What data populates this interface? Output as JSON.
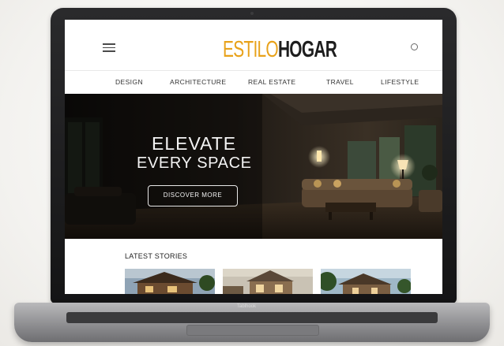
{
  "site": {
    "logo_part_a": "ESTILO",
    "logo_part_b": "HOGAR"
  },
  "nav": {
    "items": [
      {
        "label": "DESIGN"
      },
      {
        "label": "ARCHITECTURE"
      },
      {
        "label": "REAL ESTATE"
      },
      {
        "label": "TRAVEL"
      },
      {
        "label": "LIFESTYLE"
      }
    ]
  },
  "hero": {
    "headline_line1": "ELEVATE",
    "headline_line2": "EVERY SPACE",
    "cta_label": "DISCOVER MORE"
  },
  "stories": {
    "title": "LATEST STORIES"
  },
  "device": {
    "base_label": "Tablhook"
  },
  "colors": {
    "accent": "#e8a21a",
    "logo_dark": "#1e1e1e",
    "hero_overlay": "#1b1612",
    "laptop_frame": "#1c1c1d"
  },
  "icons": {
    "menu": "hamburger-icon",
    "search": "search-icon"
  }
}
